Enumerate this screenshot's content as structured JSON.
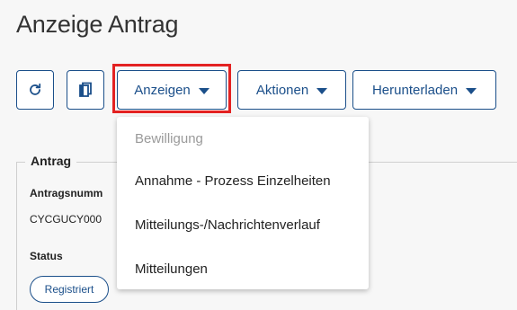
{
  "page": {
    "title": "Anzeige Antrag"
  },
  "toolbar": {
    "view_label": "Anzeigen",
    "actions_label": "Aktionen",
    "download_label": "Herunterladen"
  },
  "dropdown": {
    "items": [
      {
        "label": "Bewilligung",
        "disabled": true
      },
      {
        "label": "Annahme - Prozess Einzelheiten",
        "disabled": false
      },
      {
        "label": "Mitteilungs-/Nachrichtenverlauf",
        "disabled": false
      },
      {
        "label": "Mitteilungen",
        "disabled": false
      }
    ]
  },
  "panel": {
    "legend": "Antrag",
    "number_label": "Antragsnumm",
    "number_value": "CYCGUCY000",
    "status_label": "Status",
    "status_value": "Registriert"
  },
  "colors": {
    "accent": "#1b4f8a",
    "highlight": "#e32222",
    "background": "#f7f7f7"
  }
}
